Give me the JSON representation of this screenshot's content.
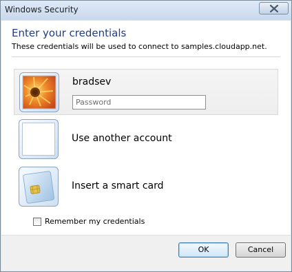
{
  "window": {
    "title": "Windows Security"
  },
  "dialog": {
    "heading": "Enter your credentials",
    "subtext": "These credentials will be used to connect to samples.cloudapp.net."
  },
  "credentials": [
    {
      "label": "bradsev",
      "icon": "flower-user-picture-icon",
      "selected": true,
      "password_placeholder": "Password",
      "password_value": ""
    },
    {
      "label": "Use another account",
      "icon": "blank-user-picture-icon",
      "selected": false
    },
    {
      "label": "Insert a smart card",
      "icon": "smart-card-icon",
      "selected": false
    }
  ],
  "remember": {
    "label": "Remember my credentials",
    "checked": false
  },
  "buttons": {
    "ok_label": "OK",
    "cancel_label": "Cancel"
  },
  "colors": {
    "heading": "#1f3d87",
    "titlebar": "#d9e4f1",
    "footer": "#f0f0f0"
  }
}
